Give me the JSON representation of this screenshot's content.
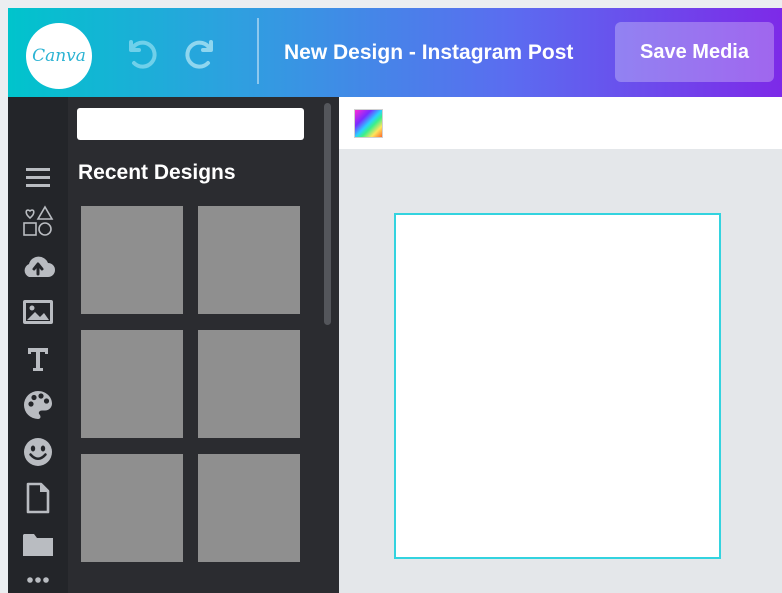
{
  "app": {
    "logo_text": "Canva",
    "title": "New Design - Instagram Post",
    "save_label": "Save Media",
    "colors": {
      "gradient_start": "#00c4cc",
      "gradient_end": "#7d2ae8",
      "sidebar_bg": "#232529",
      "panel_bg": "#2b2c30",
      "thumb_bg": "#8f8f8f",
      "page_border": "#33d3df"
    }
  },
  "header": {
    "undo_icon": "undo-icon",
    "redo_icon": "redo-icon"
  },
  "sidebar": {
    "tools": [
      {
        "name": "menu-icon"
      },
      {
        "name": "shapes-icon"
      },
      {
        "name": "upload-icon"
      },
      {
        "name": "image-icon"
      },
      {
        "name": "text-icon"
      },
      {
        "name": "palette-icon"
      },
      {
        "name": "emoji-icon"
      },
      {
        "name": "document-icon"
      },
      {
        "name": "folder-icon"
      },
      {
        "name": "more-icon"
      }
    ]
  },
  "panel": {
    "search_placeholder": "",
    "section_title": "Recent Designs",
    "thumbnails": 6
  },
  "toolbar": {
    "color_picker_icon": "color-picker-icon"
  }
}
